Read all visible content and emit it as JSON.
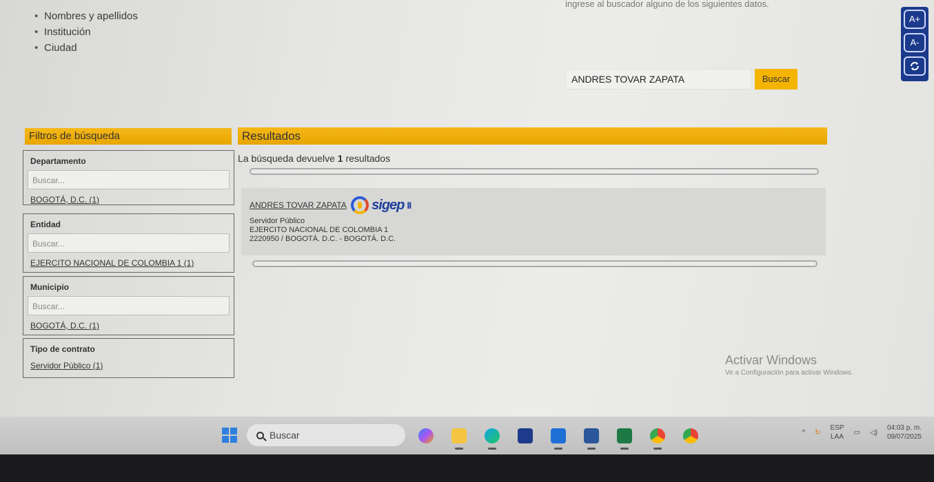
{
  "top_list": [
    "Nombres y apellidos",
    "Institución",
    "Ciudad"
  ],
  "top_hint": "ingrese al buscador alguno de los siguientes datos.",
  "accessibility": {
    "increase": "A+",
    "decrease": "A-",
    "reset_icon": "refresh-icon"
  },
  "search": {
    "value": "ANDRES TOVAR ZAPATA",
    "button": "Buscar"
  },
  "filters": {
    "title": "Filtros de búsqueda",
    "departamento": {
      "label": "Departamento",
      "placeholder": "Buscar...",
      "option": "BOGOTÁ, D.C. (1)"
    },
    "entidad": {
      "label": "Entidad",
      "placeholder": "Buscar...",
      "option": "EJERCITO NACIONAL DE COLOMBIA 1 (1)"
    },
    "municipio": {
      "label": "Municipio",
      "placeholder": "Buscar...",
      "option": "BOGOTÁ, D.C. (1)"
    },
    "tipo_contrato": {
      "label": "Tipo de contrato",
      "option": "Servidor Público (1)"
    }
  },
  "results": {
    "title": "Resultados",
    "count_prefix": "La búsqueda devuelve",
    "count": "1",
    "count_suffix": "resultados",
    "items": [
      {
        "name": "ANDRES TOVAR ZAPATA",
        "logo": "sigep",
        "logo_suffix": "II",
        "role": "Servidor Público",
        "entity": "EJERCITO NACIONAL DE COLOMBIA 1",
        "location": "2220950 / BOGOTÁ. D.C. - BOGOTÁ. D.C."
      }
    ]
  },
  "watermark": {
    "title": "Activar Windows",
    "subtitle": "Ve a Configuración para activar Windows."
  },
  "taskbar": {
    "search_placeholder": "Buscar",
    "apps": [
      "copilot-icon",
      "file-explorer-icon",
      "edge-icon",
      "store-icon",
      "outlook-icon",
      "word-icon",
      "excel-icon",
      "chrome-icon",
      "chrome-alt-icon"
    ],
    "lang_top": "ESP",
    "lang_bottom": "LAA",
    "time": "04:03 p. m.",
    "date": "09/07/2025"
  },
  "colors": {
    "accent": "#f4b400",
    "access_bg": "#1b3a8c",
    "link": "#1f3f9c"
  }
}
